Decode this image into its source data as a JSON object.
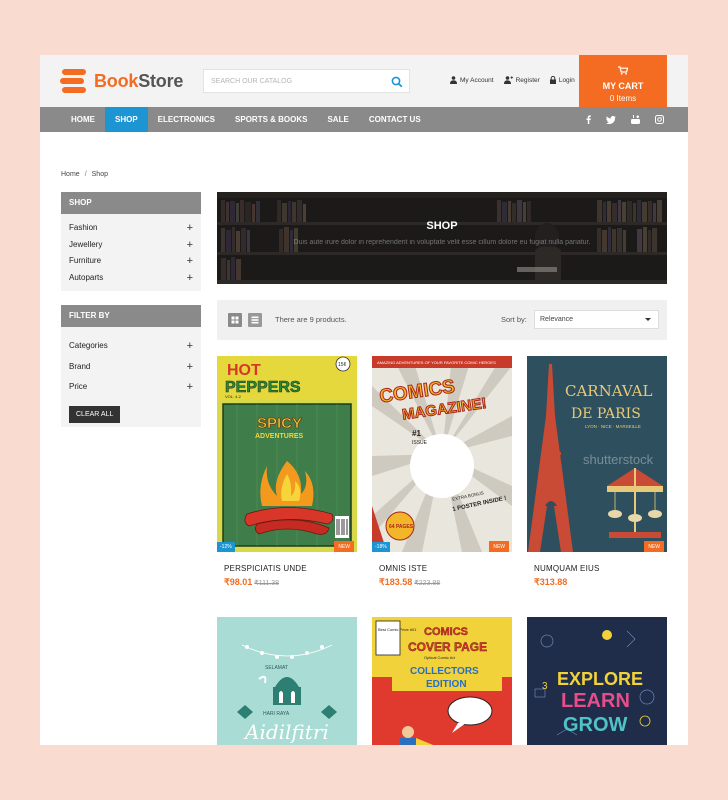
{
  "brand": {
    "name_a": "Book",
    "name_b": "Store",
    "accent": "#f36c21"
  },
  "search": {
    "placeholder": "SEARCH OUR CATALOG"
  },
  "account": {
    "my_account": "My Account",
    "register": "Register",
    "login": "Login"
  },
  "cart": {
    "title": "MY CART",
    "count": "0 Items"
  },
  "nav": {
    "items": [
      "HOME",
      "SHOP",
      "ELECTRONICS",
      "SPORTS & BOOKS",
      "SALE",
      "CONTACT US"
    ],
    "active": "SHOP",
    "social": [
      "facebook-icon",
      "twitter-icon",
      "youtube-icon",
      "instagram-icon"
    ]
  },
  "breadcrumb": {
    "home": "Home",
    "sep": "/",
    "current": "Shop"
  },
  "sidebar": {
    "shop_title": "SHOP",
    "shop_items": [
      "Fashion",
      "Jewellery",
      "Furniture",
      "Autoparts"
    ],
    "filter_title": "FILTER BY",
    "filter_items": [
      "Categories",
      "Brand",
      "Price"
    ],
    "clear_label": "CLEAR ALL"
  },
  "banner": {
    "title": "SHOP",
    "subtitle": "Duis aute irure dolor in reprehenderit in voluptate velit esse cillum dolore eu fugiat nulla pariatur."
  },
  "toolbar": {
    "count_text": "There are 9 products.",
    "sort_label": "Sort by:",
    "sort_value": "Relevance"
  },
  "products": [
    {
      "name": "PERSPICIATIS UNDE",
      "price": "₹98.01",
      "old_price": "₹111.38",
      "sale_badge": "-12%",
      "new_badge": "NEW"
    },
    {
      "name": "OMNIS ISTE",
      "price": "₹183.58",
      "old_price": "₹223.88",
      "sale_badge": "-18%",
      "new_badge": "NEW"
    },
    {
      "name": "NUMQUAM EIUS",
      "price": "₹313.88",
      "new_badge": "NEW"
    },
    {
      "name": "",
      "price": ""
    },
    {
      "name": "",
      "price": ""
    },
    {
      "name": "",
      "price": ""
    }
  ],
  "covers": {
    "hot_peppers": {
      "title_a": "HOT",
      "title_b": "PEPPERS",
      "sub": "SPICY",
      "sub2": "ADVENTURES",
      "tag": "15¢",
      "vol": "VOL. 4.2"
    },
    "comics_mag": {
      "top": "AMAZING ADVENTURES OF YOUR FAVORITE COMIC HEROES",
      "title": "COMICS",
      "title2": "MAGAZINE!",
      "no": "#1",
      "issue": "ISSUE",
      "pages": "64 PAGES",
      "inside": "1 POSTER INSIDE !",
      "extra": "EXTRA BONUS"
    },
    "paris": {
      "title": "CARNAVAL",
      "title2": "DE PARIS",
      "sub": "LYON · NICE · MARSEILLE",
      "watermark": "shutterstock"
    },
    "aidil": {
      "line1": "SELAMAT",
      "line2": "HARI RAYA",
      "line3": "Aidilfitri"
    },
    "comics_cover": {
      "corner": "Best Comic Price #01",
      "title": "COMICS",
      "title2": "COVER PAGE",
      "sub": "Optical Comic Art",
      "ed": "COLLECTORS",
      "ed2": "EDITION"
    },
    "explore": {
      "w1": "EXPLORE",
      "w2": "LEARN",
      "w3": "GROW"
    }
  }
}
